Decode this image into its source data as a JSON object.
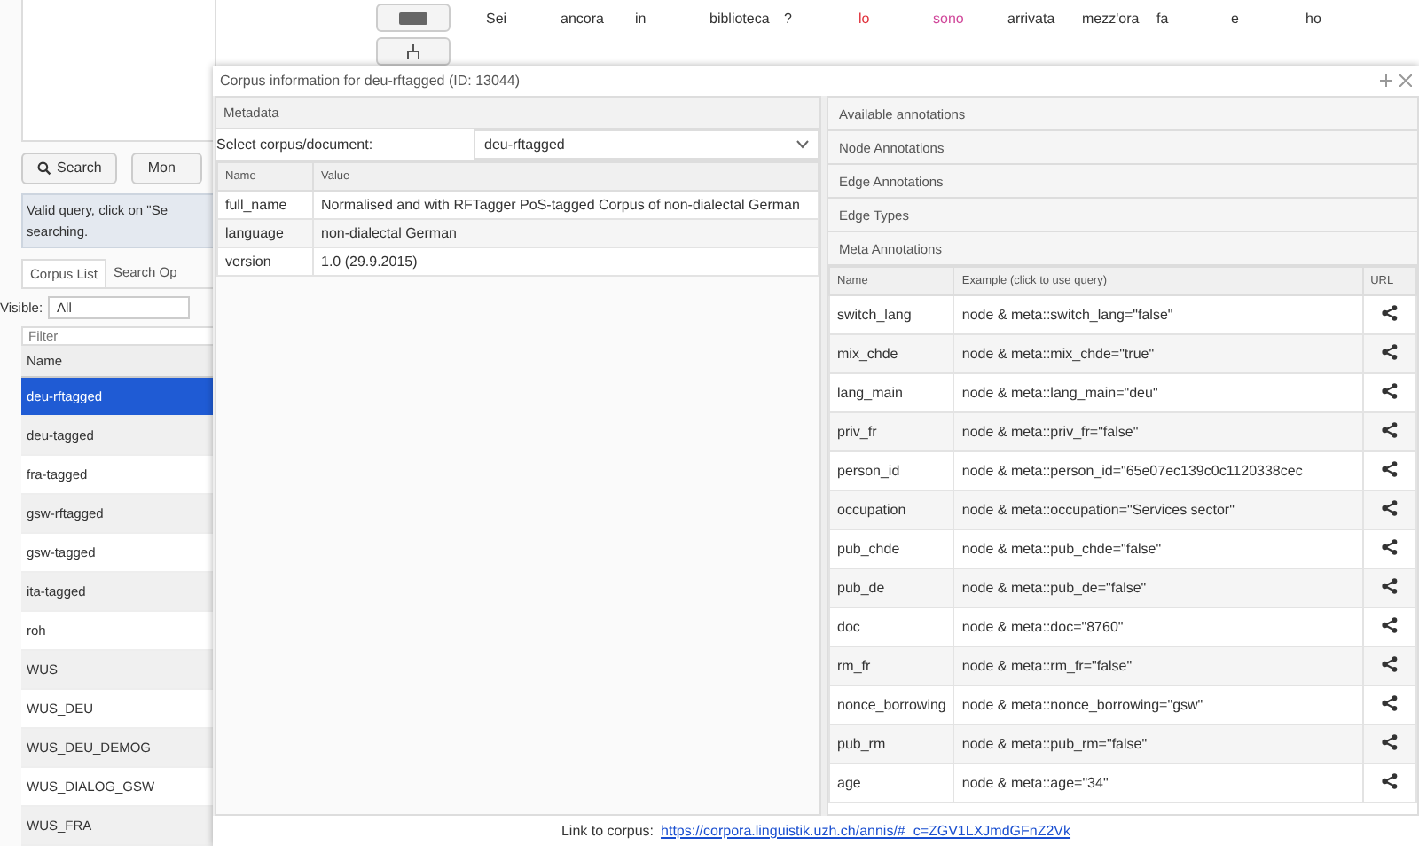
{
  "search_panel": {
    "search_button": "Search",
    "more_button": "Mon",
    "status": "Valid query, click on \"Se\nsearching.",
    "tabs": [
      {
        "label": "Corpus List",
        "selected": true
      },
      {
        "label": "Search Op",
        "selected": false
      }
    ],
    "visible_label": "Visible:",
    "visible_value": "All",
    "filter_placeholder": "Filter",
    "list_header": "Name",
    "corpora": [
      {
        "name": "deu-rftagged",
        "selected": true
      },
      {
        "name": "deu-tagged",
        "selected": false
      },
      {
        "name": "fra-tagged",
        "selected": false
      },
      {
        "name": "gsw-rftagged",
        "selected": false
      },
      {
        "name": "gsw-tagged",
        "selected": false
      },
      {
        "name": "ita-tagged",
        "selected": false
      },
      {
        "name": "roh",
        "selected": false
      },
      {
        "name": "WUS",
        "selected": false
      },
      {
        "name": "WUS_DEU",
        "selected": false
      },
      {
        "name": "WUS_DEU_DEMOG",
        "selected": false
      },
      {
        "name": "WUS_DIALOG_GSW",
        "selected": false
      },
      {
        "name": "WUS_FRA",
        "selected": false
      }
    ]
  },
  "result": {
    "tokens": [
      {
        "text": "Sei",
        "color": "#333333"
      },
      {
        "text": "ancora",
        "color": "#333333"
      },
      {
        "text": "in",
        "color": "#333333"
      },
      {
        "text": "biblioteca",
        "color": "#333333"
      },
      {
        "text": "?",
        "color": "#333333"
      },
      {
        "text": "lo",
        "color": "#e0303a"
      },
      {
        "text": "sono",
        "color": "#d0479a"
      },
      {
        "text": "arrivata",
        "color": "#333333"
      },
      {
        "text": "mezz'ora",
        "color": "#333333"
      },
      {
        "text": "fa",
        "color": "#333333"
      },
      {
        "text": "e",
        "color": "#333333"
      },
      {
        "text": "ho",
        "color": "#333333"
      }
    ]
  },
  "dialog": {
    "title": "Corpus information for deu-rftagged (ID: 13044)",
    "metadata": {
      "header": "Metadata",
      "select_label": "Select corpus/document:",
      "select_value": "deu-rftagged",
      "columns": [
        "Name",
        "Value"
      ],
      "rows": [
        [
          "full_name",
          "Normalised and with RFTagger PoS-tagged Corpus of non-dialectal German"
        ],
        [
          "language",
          "non-dialectal German"
        ],
        [
          "version",
          "1.0 (29.9.2015)"
        ]
      ]
    },
    "annotations": {
      "sections": [
        "Available annotations",
        "Node Annotations",
        "Edge Annotations",
        "Edge Types",
        "Meta Annotations"
      ],
      "columns": [
        "Name",
        "Example (click to use query)",
        "URL"
      ],
      "rows": [
        [
          "switch_lang",
          "node & meta::switch_lang=\"false\""
        ],
        [
          "mix_chde",
          "node & meta::mix_chde=\"true\""
        ],
        [
          "lang_main",
          "node & meta::lang_main=\"deu\""
        ],
        [
          "priv_fr",
          "node & meta::priv_fr=\"false\""
        ],
        [
          "person_id",
          "node & meta::person_id=\"65e07ec139c0c1120338cec"
        ],
        [
          "occupation",
          "node & meta::occupation=\"Services sector\""
        ],
        [
          "pub_chde",
          "node & meta::pub_chde=\"false\""
        ],
        [
          "pub_de",
          "node & meta::pub_de=\"false\""
        ],
        [
          "doc",
          "node & meta::doc=\"8760\""
        ],
        [
          "rm_fr",
          "node & meta::rm_fr=\"false\""
        ],
        [
          "nonce_borrowing",
          "node & meta::nonce_borrowing=\"gsw\""
        ],
        [
          "pub_rm",
          "node & meta::pub_rm=\"false\""
        ],
        [
          "age",
          "node & meta::age=\"34\""
        ]
      ]
    },
    "link_label": "Link to corpus:",
    "link_url": "https://corpora.linguistik.uzh.ch/annis/#_c=ZGV1LXJmdGFnZ2Vk"
  }
}
